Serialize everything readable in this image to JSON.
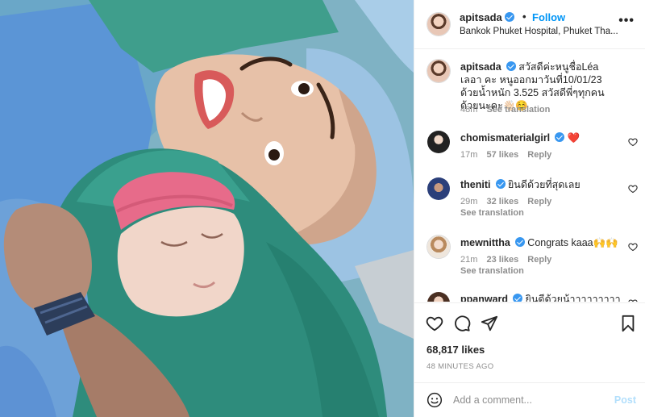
{
  "header": {
    "username": "apitsada",
    "follow_label": "Follow",
    "separator": "•",
    "location": "Bankok Phuket Hospital, Phuket Tha...",
    "more_label": "•••"
  },
  "caption": {
    "username": "apitsada",
    "text": "สวัสดีค่ะหนูชื่อLéa เลอา คะ หนูออกมาวันที่10/01/23 ด้วยน้ำหนัก 3.525 สวัสดีพี่ๆทุกคนด้วยนะคะ👋🏻☺️",
    "time": "48m",
    "see_translation": "See translation"
  },
  "comments": [
    {
      "username": "chomismaterialgirl",
      "text": "❤️",
      "time": "17m",
      "likes": "57 likes",
      "reply": "Reply",
      "see_translation": ""
    },
    {
      "username": "theniti",
      "text": "ยินดีด้วยที่สุดเลย",
      "time": "29m",
      "likes": "32 likes",
      "reply": "Reply",
      "see_translation": "See translation"
    },
    {
      "username": "mewnittha",
      "text": "Congrats kaaa🙌🙌",
      "time": "21m",
      "likes": "23 likes",
      "reply": "Reply",
      "see_translation": "See translation"
    },
    {
      "username": "ppanward",
      "text": "ยินดีด้วยน้าาาาาาาาา ❤️",
      "time": "",
      "likes": "",
      "reply": "",
      "see_translation": ""
    }
  ],
  "actions": {
    "likes_count": "68,817 likes",
    "time_ago": "48 MINUTES AGO",
    "icons": [
      "heart-icon",
      "comment-icon",
      "share-icon",
      "bookmark-icon"
    ]
  },
  "add_comment": {
    "placeholder": "Add a comment...",
    "post_label": "Post"
  },
  "colors": {
    "accent": "#0095f6",
    "post_disabled": "#b2dffc",
    "verified": "#3897f0",
    "like_red": "#ed4956",
    "muted": "#8e8e8e"
  }
}
